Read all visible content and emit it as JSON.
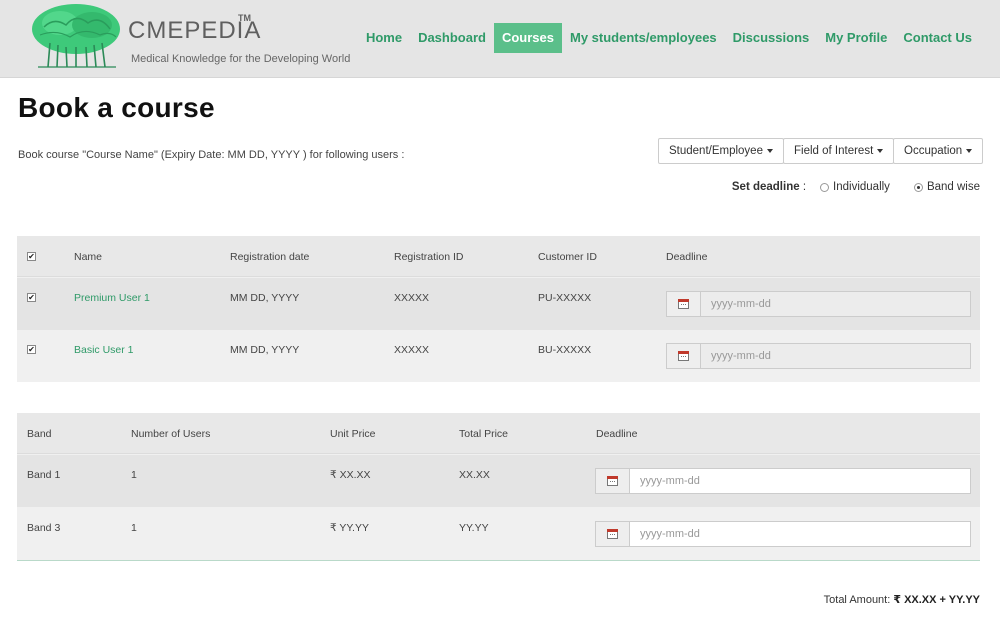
{
  "brand": {
    "name": "CMEPEDIA",
    "tm": "TM",
    "tagline": "Medical Knowledge for the Developing World"
  },
  "nav": {
    "home": "Home",
    "dashboard": "Dashboard",
    "courses": "Courses",
    "students": "My students/employees",
    "discussions": "Discussions",
    "profile": "My Profile",
    "contact": "Contact Us",
    "active": "Courses"
  },
  "page": {
    "title": "Book a course",
    "intro": "Book course \"Course Name\" (Expiry Date: MM DD, YYYY ) for following users :"
  },
  "filters": {
    "student_employee": "Student/Employee",
    "field_of_interest": "Field of Interest",
    "occupation": "Occupation"
  },
  "deadline": {
    "label": "Set deadline",
    "colon": ":",
    "individually": "Individually",
    "band_wise": "Band wise",
    "selected": "Band wise"
  },
  "users_table": {
    "headers": {
      "name": "Name",
      "registration_date": "Registration date",
      "registration_id": "Registration ID",
      "customer_id": "Customer ID",
      "deadline": "Deadline"
    },
    "rows": [
      {
        "checked": true,
        "name": "Premium User 1",
        "registration_date": "MM DD, YYYY",
        "registration_id": "XXXXX",
        "customer_id": "PU-XXXXX",
        "deadline_placeholder": "yyyy-mm-dd"
      },
      {
        "checked": true,
        "name": "Basic User 1",
        "registration_date": "MM DD, YYYY",
        "registration_id": "XXXXX",
        "customer_id": "BU-XXXXX",
        "deadline_placeholder": "yyyy-mm-dd"
      }
    ]
  },
  "bands_table": {
    "headers": {
      "band": "Band",
      "number_of_users": "Number of Users",
      "unit_price": "Unit Price",
      "total_price": "Total Price",
      "deadline": "Deadline"
    },
    "rows": [
      {
        "band": "Band 1",
        "number_of_users": "1",
        "unit_price": "₹ XX.XX",
        "total_price": "XX.XX",
        "deadline_placeholder": "yyyy-mm-dd"
      },
      {
        "band": "Band 3",
        "number_of_users": "1",
        "unit_price": "₹ YY.YY",
        "total_price": "YY.YY",
        "deadline_placeholder": "yyyy-mm-dd"
      }
    ]
  },
  "total": {
    "label": "Total Amount:",
    "value": "₹ XX.XX + YY.YY"
  },
  "colors": {
    "accent": "#2f9a68",
    "nav_active_bg": "#5bbf8a",
    "header_bg": "#e5e5e5"
  }
}
